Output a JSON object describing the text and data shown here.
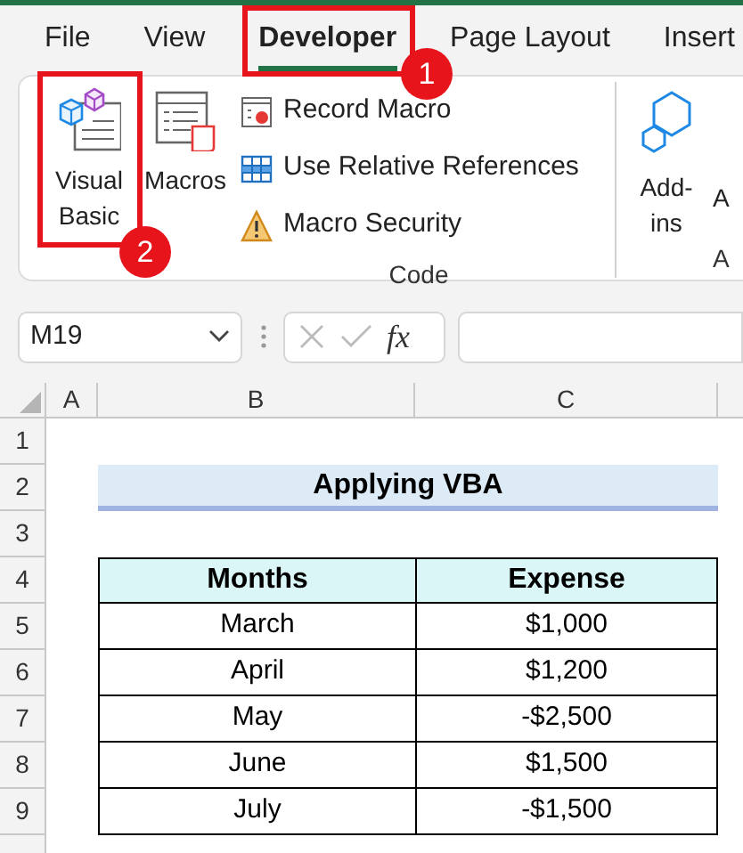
{
  "tabs": [
    {
      "label": "File",
      "selected": false
    },
    {
      "label": "View",
      "selected": false
    },
    {
      "label": "Developer",
      "selected": true
    },
    {
      "label": "Page Layout",
      "selected": false
    },
    {
      "label": "Insert",
      "selected": false
    }
  ],
  "ribbon": {
    "large_buttons": [
      {
        "kind": "visual_basic",
        "label": "Visual\nBasic"
      },
      {
        "kind": "macros",
        "label": "Macros"
      }
    ],
    "commands": [
      {
        "kind": "record",
        "label": "Record Macro"
      },
      {
        "kind": "relative",
        "label": "Use Relative References"
      },
      {
        "kind": "security",
        "label": "Macro Security"
      }
    ],
    "group_label": "Code",
    "next_group": {
      "button": "Add-\nins",
      "cut_button": "A",
      "cut_label": "A"
    }
  },
  "formula_bar": {
    "name_box": "M19",
    "function_label": "fx"
  },
  "sheet": {
    "columns": [
      "A",
      "B",
      "C"
    ],
    "row_numbers": [
      "1",
      "2",
      "3",
      "4",
      "5",
      "6",
      "7",
      "8",
      "9"
    ],
    "title": "Applying VBA",
    "table": {
      "columns": [
        "Months",
        "Expense"
      ],
      "rows": [
        [
          "March",
          "$1,000"
        ],
        [
          "April",
          "$1,200"
        ],
        [
          "May",
          "-$2,500"
        ],
        [
          "June",
          "$1,500"
        ],
        [
          "July",
          "-$1,500"
        ]
      ]
    }
  },
  "callouts": [
    {
      "label": "1"
    },
    {
      "label": "2"
    }
  ]
}
